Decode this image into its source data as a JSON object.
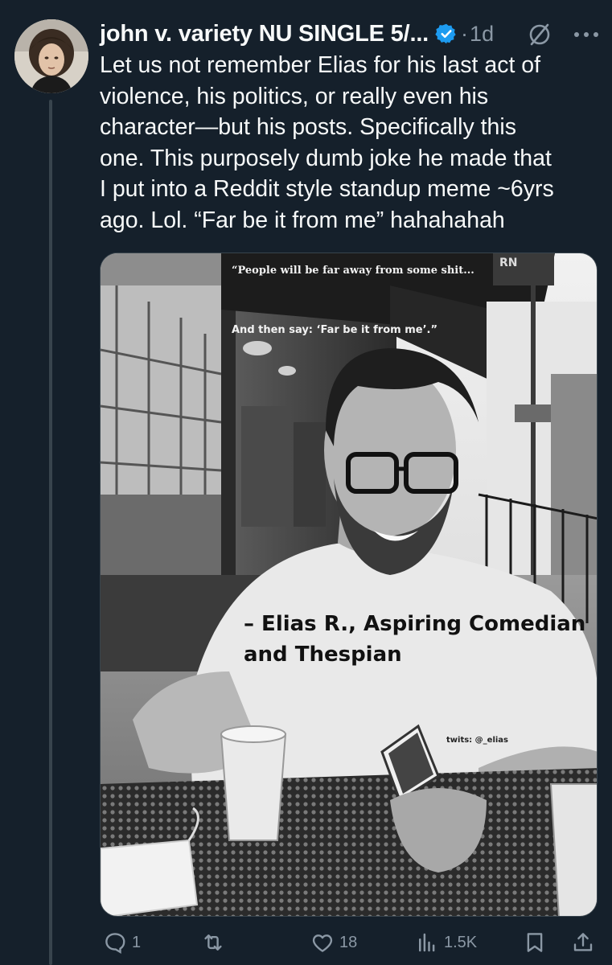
{
  "tweet": {
    "display_name": "john v. variety NU SINGLE 5/...",
    "verified": true,
    "separator": "·",
    "time": "1d",
    "text": "Let us not remember Elias for his last act of\nviolence, his politics, or really even his\ncharacter—but his posts. Specifically this\none. This purposely dumb joke he made that\nI put into a Reddit style standup meme ~6yrs\nago. Lol. “Far be it from me” hahahahah",
    "avatar_icon": "avatar-photo",
    "header_icons": [
      "verified-badge-icon",
      "grok-icon",
      "more-icon"
    ]
  },
  "media": {
    "quote_line_1": "“People will be far away from some shit...",
    "quote_line_2": "And then say: ‘Far be it from me’.”",
    "attribution": "– Elias R., Aspiring Comedian\nand Thespian",
    "handle": "twits: @_elias",
    "sign_text": "RN"
  },
  "actions": {
    "reply_count": "1",
    "retweet_count": "",
    "like_count": "18",
    "views_count": "1.5K",
    "icons": [
      "reply-icon",
      "retweet-icon",
      "like-icon",
      "views-icon",
      "bookmark-icon",
      "share-icon"
    ]
  },
  "colors": {
    "background": "#15202b",
    "text": "#f7f9f9",
    "secondary": "#8b98a5",
    "verified_blue": "#1d9bf0",
    "thread_line": "#38444d"
  }
}
